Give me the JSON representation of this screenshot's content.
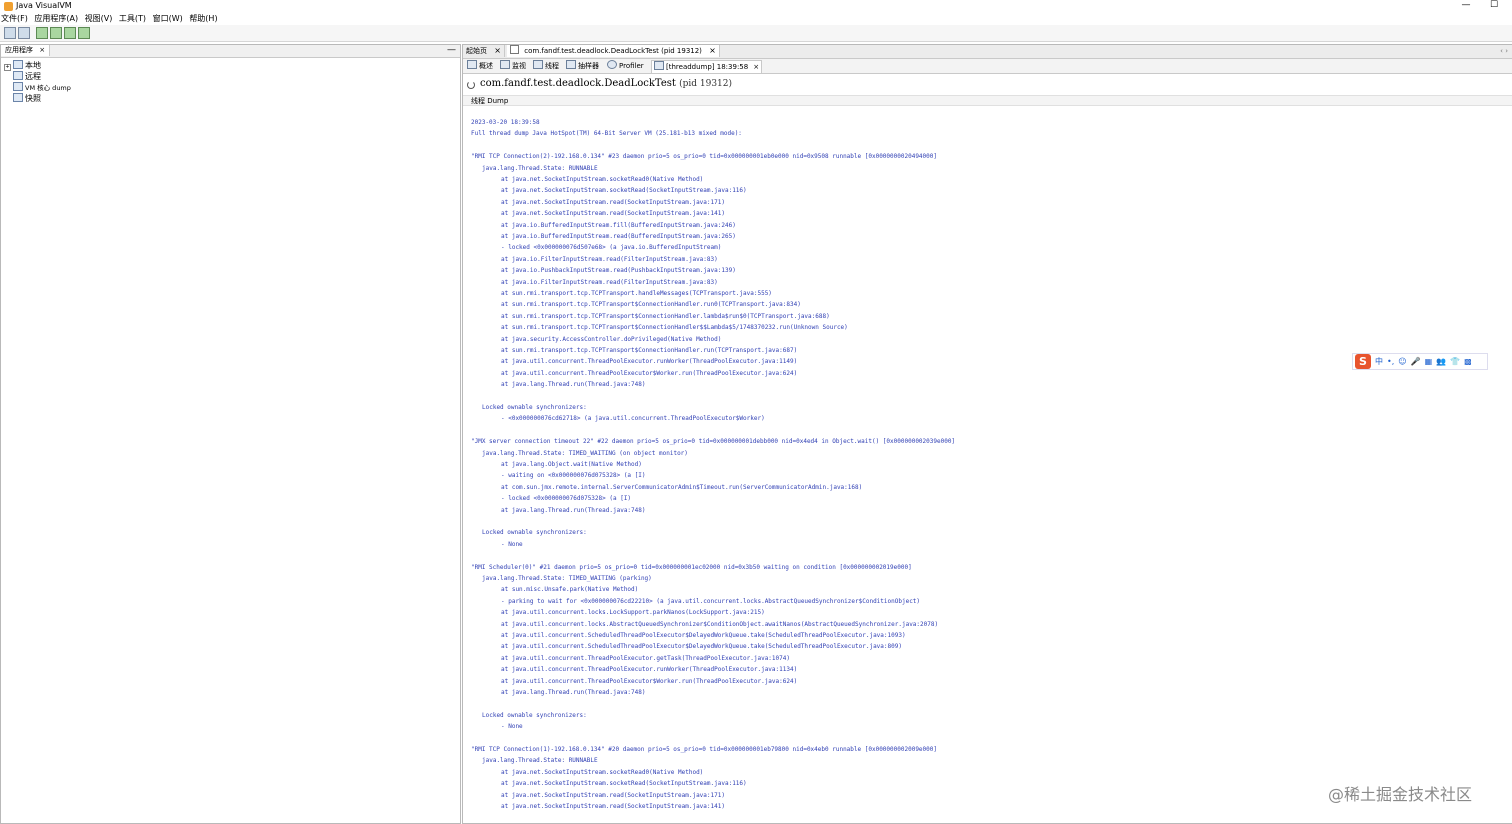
{
  "window": {
    "title": "Java VisualVM",
    "minimize": "—",
    "maximize": "☐"
  },
  "menu": [
    "文件(F)",
    "应用程序(A)",
    "视图(V)",
    "工具(T)",
    "窗口(W)",
    "帮助(H)"
  ],
  "left_panel": {
    "tab_label": "应用程序",
    "tab_close": "×",
    "minimize": "—",
    "tree": [
      {
        "label": "本地",
        "expander": "+"
      },
      {
        "label": "远程"
      },
      {
        "label": "VM 核心 dump"
      },
      {
        "label": "快照"
      }
    ]
  },
  "doc_tabs": [
    {
      "label": "起始页",
      "close": "×"
    },
    {
      "label": "com.fandf.test.deadlock.DeadLockTest (pid 19312)",
      "close": "×"
    }
  ],
  "nav_arrows": "‹ ›",
  "sub_tabs": [
    {
      "label": "概述"
    },
    {
      "label": "监视"
    },
    {
      "label": "线程"
    },
    {
      "label": "抽样器"
    },
    {
      "label": "Profiler"
    },
    {
      "label": "[threaddump] 18:39:58",
      "close": "×"
    }
  ],
  "header": {
    "title": "com.fandf.test.deadlock.DeadLockTest",
    "pid": "(pid 19312)"
  },
  "section_label": "线程 Dump",
  "dump_lines": [
    {
      "text": "2023-03-20 18:39:58",
      "indent": 0,
      "gap": 0
    },
    {
      "text": "Full thread dump Java HotSpot(TM) 64-Bit Server VM (25.181-b13 mixed mode):",
      "indent": 0,
      "gap": 0
    },
    {
      "text": "\"RMI TCP Connection(2)-192.168.0.134\" #23 daemon prio=5 os_prio=0 tid=0x000000001eb0e000 nid=0x9508 runnable [0x0000000020494000]",
      "indent": 0,
      "gap": 1
    },
    {
      "text": "java.lang.Thread.State: RUNNABLE",
      "indent": 1,
      "gap": 0
    },
    {
      "text": "at java.net.SocketInputStream.socketRead0(Native Method)",
      "indent": 2,
      "gap": 0
    },
    {
      "text": "at java.net.SocketInputStream.socketRead(SocketInputStream.java:116)",
      "indent": 2,
      "gap": 0
    },
    {
      "text": "at java.net.SocketInputStream.read(SocketInputStream.java:171)",
      "indent": 2,
      "gap": 0
    },
    {
      "text": "at java.net.SocketInputStream.read(SocketInputStream.java:141)",
      "indent": 2,
      "gap": 0
    },
    {
      "text": "at java.io.BufferedInputStream.fill(BufferedInputStream.java:246)",
      "indent": 2,
      "gap": 0
    },
    {
      "text": "at java.io.BufferedInputStream.read(BufferedInputStream.java:265)",
      "indent": 2,
      "gap": 0
    },
    {
      "text": "- locked <0x000000076d507e68> (a java.io.BufferedInputStream)",
      "indent": 2,
      "gap": 0
    },
    {
      "text": "at java.io.FilterInputStream.read(FilterInputStream.java:83)",
      "indent": 2,
      "gap": 0
    },
    {
      "text": "at java.io.PushbackInputStream.read(PushbackInputStream.java:139)",
      "indent": 2,
      "gap": 0
    },
    {
      "text": "at java.io.FilterInputStream.read(FilterInputStream.java:83)",
      "indent": 2,
      "gap": 0
    },
    {
      "text": "at sun.rmi.transport.tcp.TCPTransport.handleMessages(TCPTransport.java:555)",
      "indent": 2,
      "gap": 0
    },
    {
      "text": "at sun.rmi.transport.tcp.TCPTransport$ConnectionHandler.run0(TCPTransport.java:834)",
      "indent": 2,
      "gap": 0
    },
    {
      "text": "at sun.rmi.transport.tcp.TCPTransport$ConnectionHandler.lambda$run$0(TCPTransport.java:688)",
      "indent": 2,
      "gap": 0
    },
    {
      "text": "at sun.rmi.transport.tcp.TCPTransport$ConnectionHandler$$Lambda$5/1748370232.run(Unknown Source)",
      "indent": 2,
      "gap": 0
    },
    {
      "text": "at java.security.AccessController.doPrivileged(Native Method)",
      "indent": 2,
      "gap": 0
    },
    {
      "text": "at sun.rmi.transport.tcp.TCPTransport$ConnectionHandler.run(TCPTransport.java:687)",
      "indent": 2,
      "gap": 0
    },
    {
      "text": "at java.util.concurrent.ThreadPoolExecutor.runWorker(ThreadPoolExecutor.java:1149)",
      "indent": 2,
      "gap": 0
    },
    {
      "text": "at java.util.concurrent.ThreadPoolExecutor$Worker.run(ThreadPoolExecutor.java:624)",
      "indent": 2,
      "gap": 0
    },
    {
      "text": "at java.lang.Thread.run(Thread.java:748)",
      "indent": 2,
      "gap": 0
    },
    {
      "text": "Locked ownable synchronizers:",
      "indent": 1,
      "gap": 1
    },
    {
      "text": "- <0x000000076cd62718> (a java.util.concurrent.ThreadPoolExecutor$Worker)",
      "indent": 2,
      "gap": 0
    },
    {
      "text": "\"JMX server connection timeout 22\" #22 daemon prio=5 os_prio=0 tid=0x000000001debb000 nid=0x4ed4 in Object.wait() [0x000000002039e000]",
      "indent": 0,
      "gap": 1
    },
    {
      "text": "java.lang.Thread.State: TIMED_WAITING (on object monitor)",
      "indent": 1,
      "gap": 0
    },
    {
      "text": "at java.lang.Object.wait(Native Method)",
      "indent": 2,
      "gap": 0
    },
    {
      "text": "- waiting on <0x000000076d075328> (a [I)",
      "indent": 2,
      "gap": 0
    },
    {
      "text": "at com.sun.jmx.remote.internal.ServerCommunicatorAdmin$Timeout.run(ServerCommunicatorAdmin.java:168)",
      "indent": 2,
      "gap": 0
    },
    {
      "text": "- locked <0x000000076d075328> (a [I)",
      "indent": 2,
      "gap": 0
    },
    {
      "text": "at java.lang.Thread.run(Thread.java:748)",
      "indent": 2,
      "gap": 0
    },
    {
      "text": "Locked ownable synchronizers:",
      "indent": 1,
      "gap": 1
    },
    {
      "text": "- None",
      "indent": 2,
      "gap": 0
    },
    {
      "text": "\"RMI Scheduler(0)\" #21 daemon prio=5 os_prio=0 tid=0x000000001ec02000 nid=0x3b50 waiting on condition [0x000000002019e000]",
      "indent": 0,
      "gap": 1
    },
    {
      "text": "java.lang.Thread.State: TIMED_WAITING (parking)",
      "indent": 1,
      "gap": 0
    },
    {
      "text": "at sun.misc.Unsafe.park(Native Method)",
      "indent": 2,
      "gap": 0
    },
    {
      "text": "- parking to wait for  <0x000000076cd22210> (a java.util.concurrent.locks.AbstractQueuedSynchronizer$ConditionObject)",
      "indent": 2,
      "gap": 0
    },
    {
      "text": "at java.util.concurrent.locks.LockSupport.parkNanos(LockSupport.java:215)",
      "indent": 2,
      "gap": 0
    },
    {
      "text": "at java.util.concurrent.locks.AbstractQueuedSynchronizer$ConditionObject.awaitNanos(AbstractQueuedSynchronizer.java:2078)",
      "indent": 2,
      "gap": 0
    },
    {
      "text": "at java.util.concurrent.ScheduledThreadPoolExecutor$DelayedWorkQueue.take(ScheduledThreadPoolExecutor.java:1093)",
      "indent": 2,
      "gap": 0
    },
    {
      "text": "at java.util.concurrent.ScheduledThreadPoolExecutor$DelayedWorkQueue.take(ScheduledThreadPoolExecutor.java:809)",
      "indent": 2,
      "gap": 0
    },
    {
      "text": "at java.util.concurrent.ThreadPoolExecutor.getTask(ThreadPoolExecutor.java:1074)",
      "indent": 2,
      "gap": 0
    },
    {
      "text": "at java.util.concurrent.ThreadPoolExecutor.runWorker(ThreadPoolExecutor.java:1134)",
      "indent": 2,
      "gap": 0
    },
    {
      "text": "at java.util.concurrent.ThreadPoolExecutor$Worker.run(ThreadPoolExecutor.java:624)",
      "indent": 2,
      "gap": 0
    },
    {
      "text": "at java.lang.Thread.run(Thread.java:748)",
      "indent": 2,
      "gap": 0
    },
    {
      "text": "Locked ownable synchronizers:",
      "indent": 1,
      "gap": 1
    },
    {
      "text": "- None",
      "indent": 2,
      "gap": 0
    },
    {
      "text": "\"RMI TCP Connection(1)-192.168.0.134\" #20 daemon prio=5 os_prio=0 tid=0x000000001eb79800 nid=0x4eb0 runnable [0x000000002009e000]",
      "indent": 0,
      "gap": 1
    },
    {
      "text": "java.lang.Thread.State: RUNNABLE",
      "indent": 1,
      "gap": 0
    },
    {
      "text": "at java.net.SocketInputStream.socketRead0(Native Method)",
      "indent": 2,
      "gap": 0
    },
    {
      "text": "at java.net.SocketInputStream.socketRead(SocketInputStream.java:116)",
      "indent": 2,
      "gap": 0
    },
    {
      "text": "at java.net.SocketInputStream.read(SocketInputStream.java:171)",
      "indent": 2,
      "gap": 0
    },
    {
      "text": "at java.net.SocketInputStream.read(SocketInputStream.java:141)",
      "indent": 2,
      "gap": 0
    }
  ],
  "ime_toolbar": {
    "logo": "S",
    "items": [
      "中",
      "•,",
      "☺",
      "🎤",
      "▦",
      "👥",
      "👕",
      "▩"
    ]
  },
  "watermark": "@稀土掘金技术社区"
}
